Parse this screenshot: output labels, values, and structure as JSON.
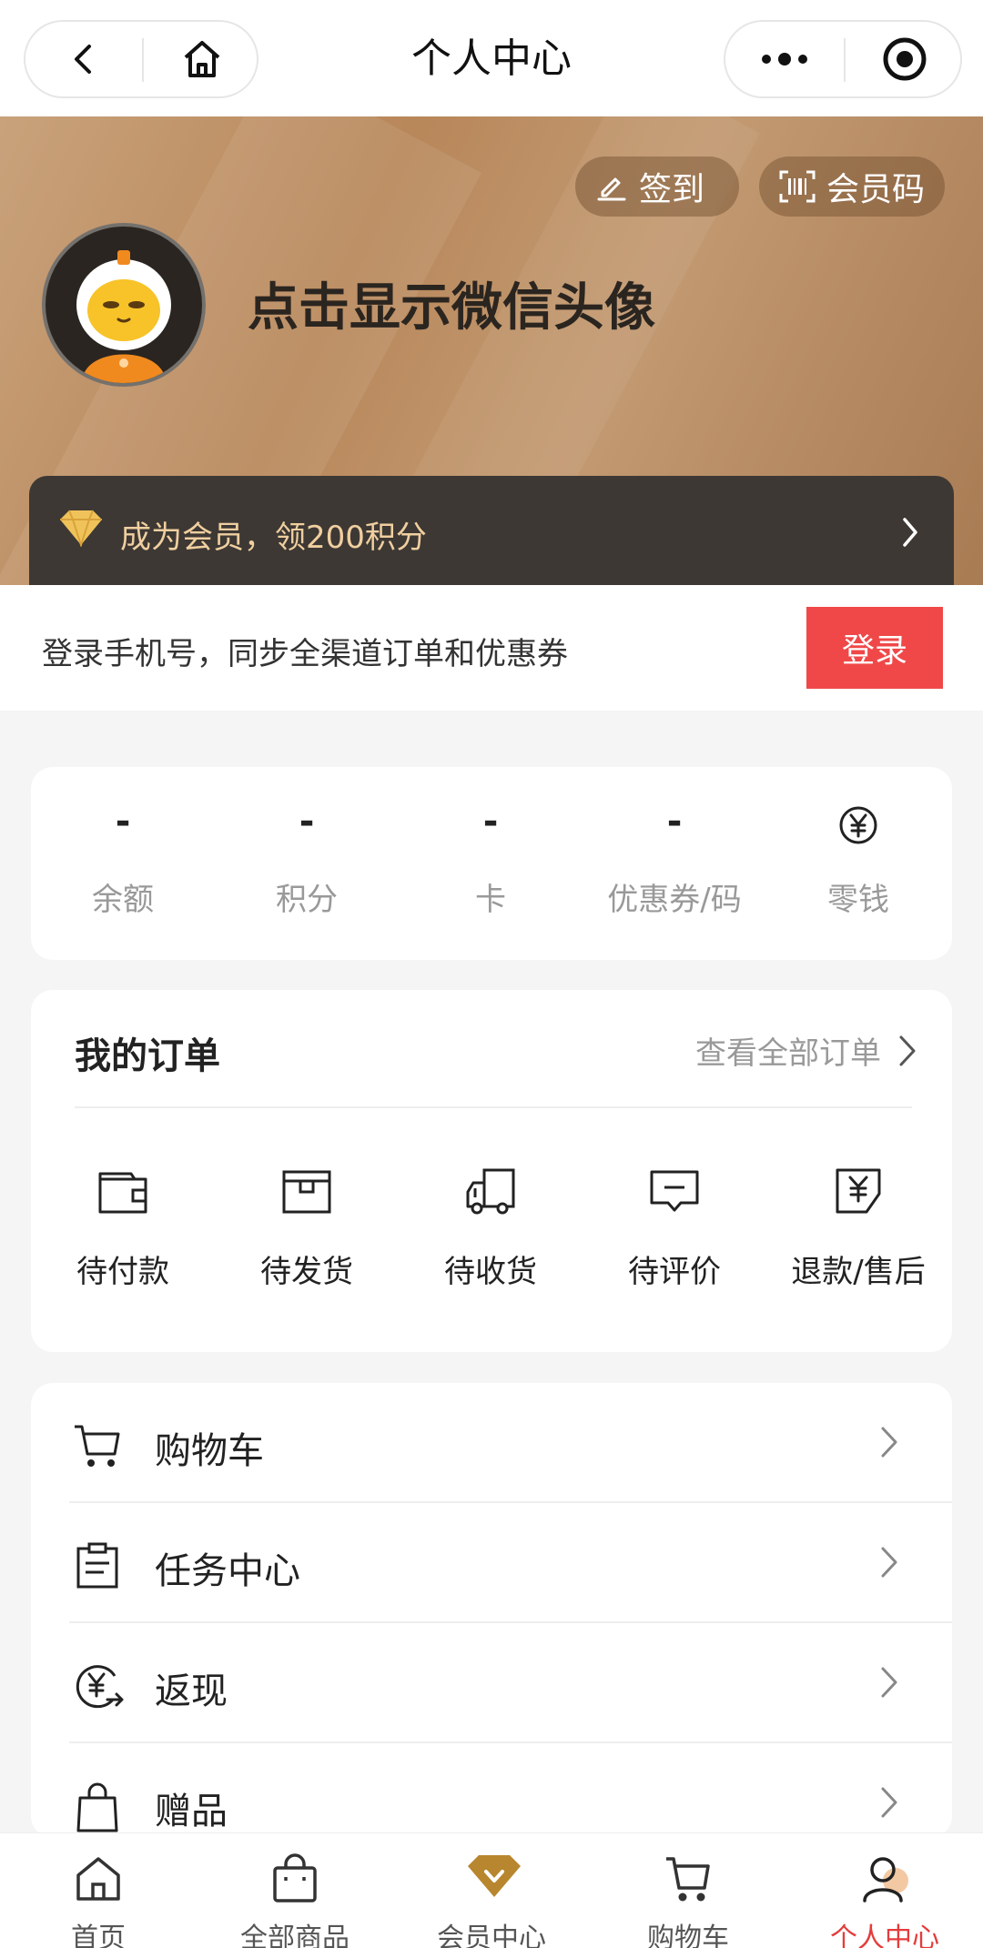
{
  "nav": {
    "title": "个人中心",
    "back_icon": "back-arrow-icon",
    "home_icon": "home-icon",
    "more_icon": "more-dots-icon",
    "close_icon": "record-target-icon"
  },
  "header": {
    "sign_in_label": "签到",
    "member_code_label": "会员码",
    "username": "点击显示微信头像",
    "member_banner": "成为会员，领200积分",
    "colors": {
      "banner": "#b8875a",
      "member_bar": "#3d3834",
      "member_text": "#f0cf9f"
    }
  },
  "login": {
    "prompt": "登录手机号，同步全渠道订单和优惠券",
    "button": "登录",
    "button_color": "#f04848"
  },
  "assets": [
    {
      "value": "-",
      "label": "余额"
    },
    {
      "value": "-",
      "label": "积分"
    },
    {
      "value": "-",
      "label": "卡"
    },
    {
      "value": "-",
      "label": "优惠券/码"
    },
    {
      "value": "",
      "label": "零钱",
      "icon": "yen-circle-icon"
    }
  ],
  "orders": {
    "title": "我的订单",
    "view_all": "查看全部订单",
    "items": [
      {
        "label": "待付款",
        "icon": "wallet-icon"
      },
      {
        "label": "待发货",
        "icon": "box-icon"
      },
      {
        "label": "待收货",
        "icon": "truck-icon"
      },
      {
        "label": "待评价",
        "icon": "comment-icon"
      },
      {
        "label": "退款/售后",
        "icon": "refund-icon"
      }
    ]
  },
  "menu": [
    {
      "label": "购物车",
      "icon": "cart-icon"
    },
    {
      "label": "任务中心",
      "icon": "clipboard-icon"
    },
    {
      "label": "返现",
      "icon": "cashback-icon"
    },
    {
      "label": "赠品",
      "icon": "gift-bag-icon"
    }
  ],
  "tabbar": [
    {
      "label": "首页",
      "icon": "home-icon"
    },
    {
      "label": "全部商品",
      "icon": "shopping-bag-icon"
    },
    {
      "label": "会员中心",
      "icon": "diamond-icon"
    },
    {
      "label": "购物车",
      "icon": "cart-icon"
    },
    {
      "label": "个人中心",
      "icon": "user-icon",
      "active": true
    }
  ]
}
